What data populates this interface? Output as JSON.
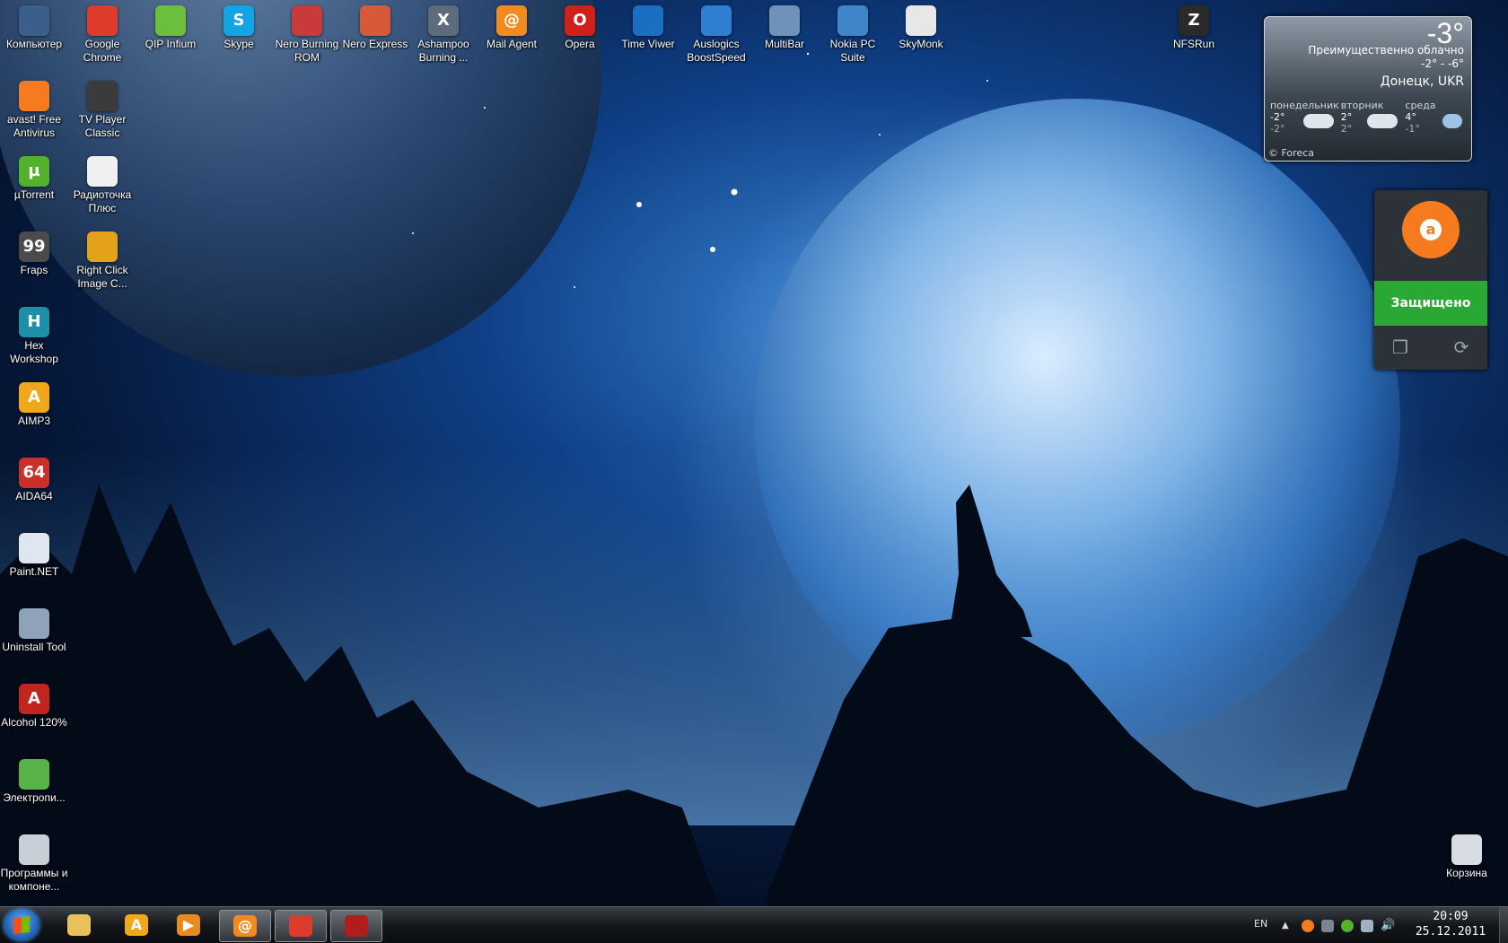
{
  "desktop": {
    "icons": [
      {
        "label": "Компьютер",
        "icon": "computer-icon",
        "color": "#3a5f8a",
        "glyph": ""
      },
      {
        "label": "Google Chrome",
        "icon": "chrome-icon",
        "color": "#dd3b2c",
        "glyph": ""
      },
      {
        "label": "QIP Infium",
        "icon": "qip-icon",
        "color": "#6cbf3a",
        "glyph": ""
      },
      {
        "label": "Skype",
        "icon": "skype-icon",
        "color": "#12a5e6",
        "glyph": "S"
      },
      {
        "label": "Nero Burning ROM",
        "icon": "nero-icon",
        "color": "#c93a3a",
        "glyph": ""
      },
      {
        "label": "Nero Express",
        "icon": "nero-express-icon",
        "color": "#d65a3a",
        "glyph": ""
      },
      {
        "label": "Ashampoo Burning ...",
        "icon": "ashampoo-icon",
        "color": "#5d6b7a",
        "glyph": "X"
      },
      {
        "label": "Mail Agent",
        "icon": "mail-agent-icon",
        "color": "#f28a1f",
        "glyph": "@"
      },
      {
        "label": "Opera",
        "icon": "opera-icon",
        "color": "#d1201c",
        "glyph": "O"
      },
      {
        "label": "Time Viwer",
        "icon": "teamviewer-icon",
        "color": "#1b6fc2",
        "glyph": ""
      },
      {
        "label": "Auslogics BoostSpeed",
        "icon": "auslogics-icon",
        "color": "#2e7fd1",
        "glyph": ""
      },
      {
        "label": "MultiBar",
        "icon": "multibar-icon",
        "color": "#6f93b8",
        "glyph": ""
      },
      {
        "label": "Nokia PC Suite",
        "icon": "nokia-icon",
        "color": "#3e86c8",
        "glyph": ""
      },
      {
        "label": "SkyMonk",
        "icon": "skymonk-icon",
        "color": "#e7e7e7",
        "glyph": ""
      },
      {
        "label": "NFSRun",
        "icon": "nfs-icon",
        "color": "#2a2a2a",
        "glyph": "Z"
      },
      {
        "label": "avast! Free Antivirus",
        "icon": "avast-icon",
        "color": "#f57b1e",
        "glyph": ""
      },
      {
        "label": "TV Player Classic",
        "icon": "tv-player-icon",
        "color": "#3b3b3b",
        "glyph": ""
      },
      {
        "label": "µTorrent",
        "icon": "utorrent-icon",
        "color": "#53b22b",
        "glyph": "µ"
      },
      {
        "label": "Радиоточка Плюс",
        "icon": "radio-icon",
        "color": "#f0f0f0",
        "glyph": ""
      },
      {
        "label": "Fraps",
        "icon": "fraps-icon",
        "color": "#4a4a4a",
        "glyph": "99"
      },
      {
        "label": "Right Click Image C...",
        "icon": "gear-icon",
        "color": "#e3a21a",
        "glyph": ""
      },
      {
        "label": "Hex Workshop",
        "icon": "hex-workshop-icon",
        "color": "#1d8fa8",
        "glyph": "H"
      },
      {
        "label": "AIMP3",
        "icon": "aimp-icon",
        "color": "#f0a81a",
        "glyph": "A"
      },
      {
        "label": "AIDA64",
        "icon": "aida64-icon",
        "color": "#c8302a",
        "glyph": "64"
      },
      {
        "label": "Paint.NET",
        "icon": "paint-net-icon",
        "color": "#e0e6f0",
        "glyph": ""
      },
      {
        "label": "Uninstall Tool",
        "icon": "uninstall-tool-icon",
        "color": "#8fa3b8",
        "glyph": ""
      },
      {
        "label": "Alcohol 120%",
        "icon": "alcohol-icon",
        "color": "#c2241f",
        "glyph": "A"
      },
      {
        "label": "Электропи...",
        "icon": "battery-icon",
        "color": "#58b448",
        "glyph": ""
      },
      {
        "label": "Программы и компоне...",
        "icon": "programs-icon",
        "color": "#c9cfd6",
        "glyph": ""
      },
      {
        "label": "Корзина",
        "icon": "recycle-bin-icon",
        "color": "#d8dde3",
        "glyph": ""
      }
    ]
  },
  "weather": {
    "temp": "-3°",
    "condition": "Преимущественно облачно",
    "range": "-2° - -6°",
    "city": "Донецк, UKR",
    "days": [
      {
        "name": "понедельник",
        "hi": "-2°",
        "lo": "-2°"
      },
      {
        "name": "вторник",
        "hi": "2°",
        "lo": "2°"
      },
      {
        "name": "среда",
        "hi": "4°",
        "lo": "-1°"
      }
    ],
    "credit": "© Foreca"
  },
  "avast_gadget": {
    "status": "Защищено",
    "status_color": "#2aa834"
  },
  "taskbar": {
    "pinned": [
      {
        "icon": "folder-icon",
        "color": "#e7c15a",
        "glyph": ""
      },
      {
        "icon": "aimp-icon",
        "color": "#f0a81a",
        "glyph": "A"
      },
      {
        "icon": "media-player-icon",
        "color": "#e88a1f",
        "glyph": "▶"
      },
      {
        "icon": "mail-agent-icon",
        "color": "#f28a1f",
        "glyph": "@"
      },
      {
        "icon": "chrome-icon",
        "color": "#dd3b2c",
        "glyph": ""
      },
      {
        "icon": "striped-app-icon",
        "color": "#b11c1c",
        "glyph": ""
      }
    ],
    "language": "EN",
    "time": "20:09",
    "date": "25.12.2011"
  }
}
